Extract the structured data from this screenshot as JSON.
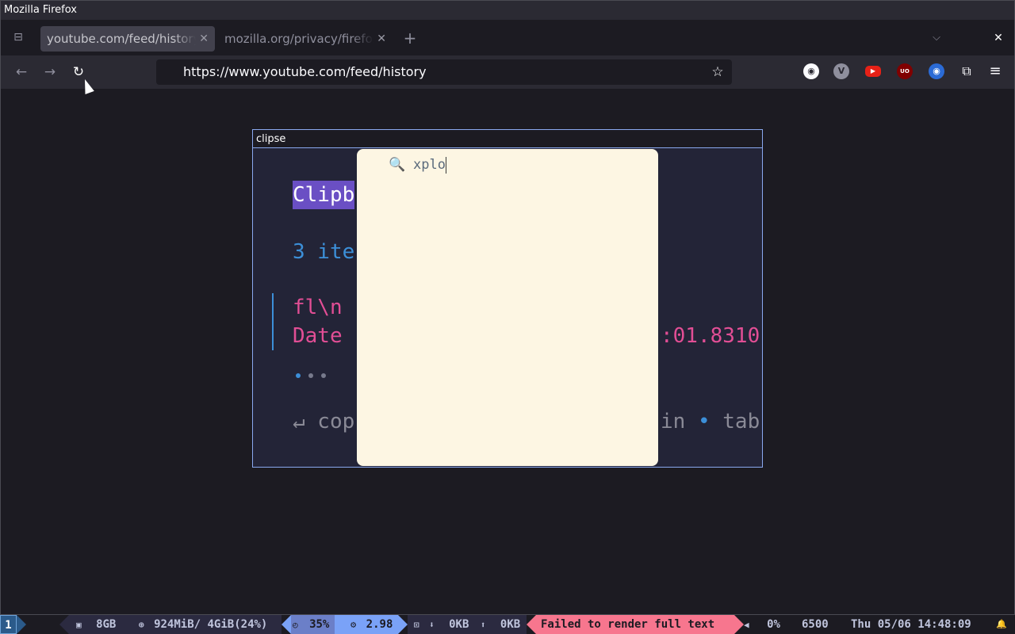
{
  "window_title": "Mozilla Firefox",
  "tabs": [
    {
      "label": "youtube.com/feed/history",
      "close": "✕"
    },
    {
      "label": "mozilla.org/privacy/firefox",
      "close": "✕"
    }
  ],
  "icons": {
    "tab_list": "⊟",
    "new_tab": "+",
    "tabs_menu": "⌵",
    "window_close": "✕",
    "back": "←",
    "forward": "→",
    "reload": "↻",
    "bookmark_star": "☆",
    "search": "🔍"
  },
  "url": "https://www.youtube.com/feed/history",
  "extensions": [
    {
      "name": "account-icon",
      "glyph": "◉",
      "color": "#42414d"
    },
    {
      "name": "vim-extension-icon",
      "glyph": "V",
      "color": "#8f8f9d"
    },
    {
      "name": "youtube-extension-icon",
      "glyph": "▶",
      "color": "#e62117"
    },
    {
      "name": "ublock-icon",
      "glyph": "UO",
      "color": "#800000"
    },
    {
      "name": "privacy-extension-icon",
      "glyph": "◉",
      "color": "#2b6bd6"
    },
    {
      "name": "extensions-puzzle-icon",
      "glyph": "⧉",
      "color": "#2b2a33"
    },
    {
      "name": "menu-hamburger-icon",
      "glyph": "≡",
      "color": "#2b2a33"
    }
  ],
  "clipse": {
    "title": "clipse",
    "header": "Clipb",
    "count": "3 ite",
    "item_title": "fl\\n",
    "item_date": "Date",
    "item_date_end": ":01.8310",
    "help_left": "↵ cop",
    "help_right_a": "in",
    "help_right_sep": " • ",
    "help_right_b": "tab"
  },
  "search": {
    "query": "xplo"
  },
  "statusbar": {
    "workspace": "1",
    "disk_icon": "▣",
    "disk": "8GB",
    "mem_icon": "⊕",
    "memory": "924MiB/ 4GiB(24%)",
    "cpu_icon": "◴",
    "cpu": "35%",
    "load_icon": "⚙",
    "load": "2.98",
    "net_icon": "⊡",
    "down_icon": "⬇",
    "down": "0KB",
    "up_icon": "⬆",
    "up": "0KB",
    "error": "Failed to render full text",
    "volume_icon": "◀",
    "volume": "0%",
    "temp": "6500",
    "datetime": "Thu 05/06 14:48:09",
    "bell_icon": "🔔"
  }
}
